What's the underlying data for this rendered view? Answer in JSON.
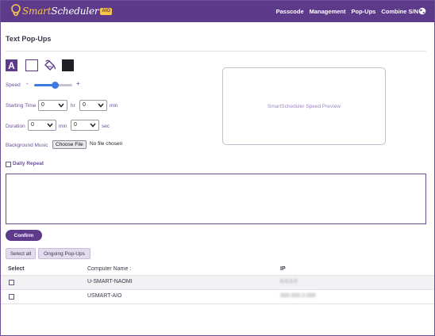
{
  "app": {
    "logo_main": "Smart",
    "logo_alt": "Scheduler",
    "logo_badge": "AIO",
    "brand_color": "#5e3a8a",
    "accent_color": "#f6c54a"
  },
  "nav": {
    "items": [
      "Passcode",
      "Management",
      "Pop-Ups",
      "Combine S/N"
    ],
    "globe_icon": "globe-icon"
  },
  "page": {
    "title": "Text Pop-Ups"
  },
  "format_toolbar": {
    "text_color_label": "A",
    "icons": [
      "text-color-icon",
      "background-white-swatch",
      "fill-bucket-icon",
      "foreground-black-swatch"
    ]
  },
  "speed": {
    "label": "Speed",
    "minus": "-",
    "plus": "+",
    "value": 0.55
  },
  "starting_time": {
    "label": "Starting Time",
    "hour_value": "0",
    "hour_unit": "hr",
    "minute_value": "0",
    "minute_unit": "min"
  },
  "duration": {
    "label": "Duration",
    "minute_value": "0",
    "minute_unit": "min",
    "second_value": "0",
    "second_unit": "sec"
  },
  "background_music": {
    "label": "Background Music",
    "choose_button": "Choose File",
    "status": "No file chosen"
  },
  "daily_repeat": {
    "label": "Daily Repeat",
    "checked": false
  },
  "preview": {
    "text": "SmartScheduler Speed Preview"
  },
  "message": {
    "value": ""
  },
  "confirm_button": "Confirm",
  "tabs": {
    "select_all": "Select all",
    "ongoing": "Ongoing Pop-Ups"
  },
  "table": {
    "headers": {
      "select": "Select",
      "computer_name": "Computer Name :",
      "ip": "IP"
    },
    "rows": [
      {
        "name": "U-SMART-NAOMI",
        "ip": "0.0.0.0",
        "checked": false
      },
      {
        "name": "USMART-AIO",
        "ip": "000.000.0.000",
        "checked": false
      }
    ]
  }
}
